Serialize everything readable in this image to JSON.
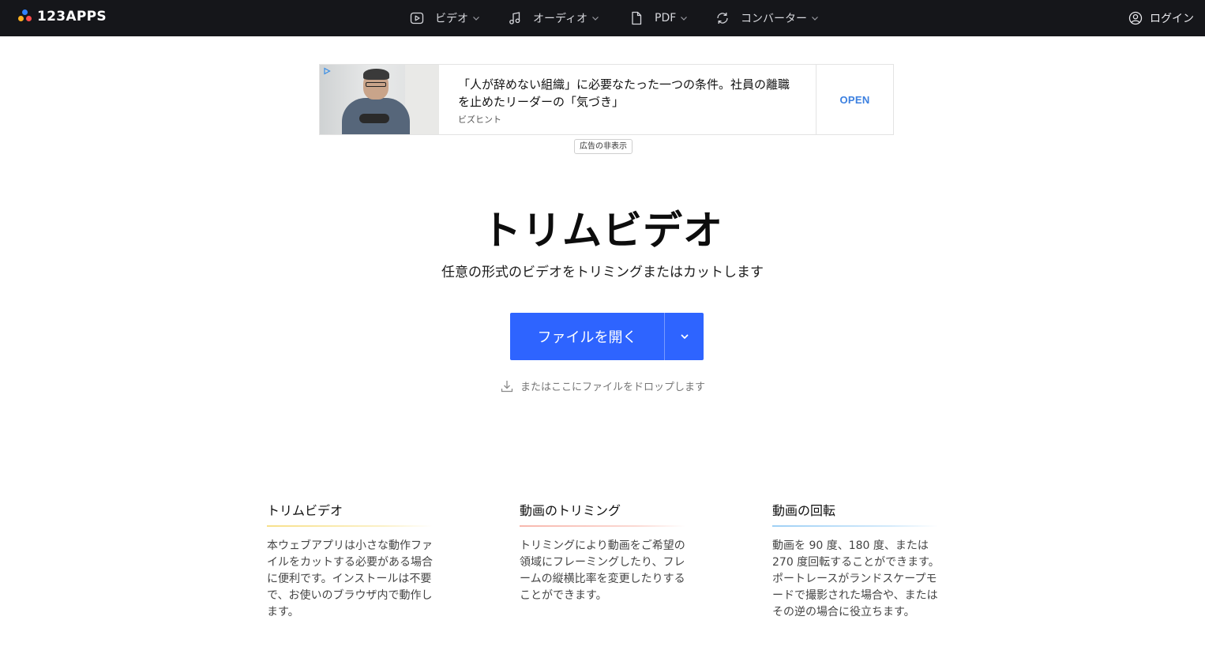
{
  "brand": {
    "name": "123APPS"
  },
  "nav": {
    "items": [
      {
        "label": "ビデオ",
        "icon": "video-play-icon"
      },
      {
        "label": "オーディオ",
        "icon": "music-note-icon"
      },
      {
        "label": "PDF",
        "icon": "document-icon"
      },
      {
        "label": "コンバーター",
        "icon": "convert-cycle-icon"
      }
    ],
    "login_label": "ログイン"
  },
  "ad": {
    "headline": "「人が辞めない組織」に必要なたった一つの条件。社員の離職を止めたリーダーの「気づき」",
    "source": "ビズヒント",
    "cta": "OPEN",
    "hide_label": "広告の非表示"
  },
  "hero": {
    "title": "トリムビデオ",
    "subtitle": "任意の形式のビデオをトリミングまたはカットします",
    "open_button": "ファイルを開く",
    "drop_hint": "またはここにファイルをドロップします"
  },
  "features": [
    {
      "title": "トリムビデオ",
      "accent": "#f7e08a",
      "text": "本ウェブアプリは小さな動作ファイルをカットする必要がある場合に便利です。インストールは不要で、お使いのブラウザ内で動作します。"
    },
    {
      "title": "動画のトリミング",
      "accent": "#f7b7ad",
      "text": "トリミングにより動画をご希望の領域にフレーミングしたり、フレームの縦横比率を変更したりすることができます。"
    },
    {
      "title": "動画の回転",
      "accent": "#9fd0f5",
      "text": "動画を 90 度、180 度、または 270 度回転することができます。ポートレースがランドスケープモードで撮影された場合や、またはその逆の場合に役立ちます。"
    }
  ],
  "colors": {
    "topbar": "#15161a",
    "primary_button": "#2e64ff",
    "ad_cta": "#3c80e0"
  }
}
